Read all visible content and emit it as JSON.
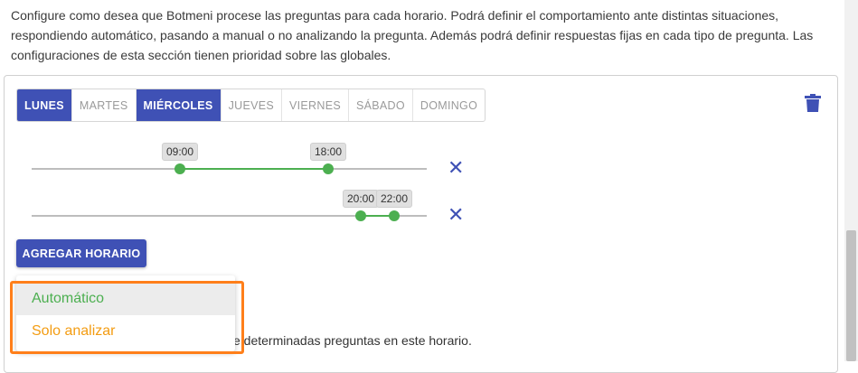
{
  "description": "Configure como desea que Botmeni procese las preguntas para cada horario. Podrá definir el comportamiento ante distintas situaciones, respondiendo automático, pasando a manual o no analizando la pregunta. Además podrá definir respuestas fijas en cada tipo de pregunta. Las configuraciones de esta sección tienen prioridad sobre las globales.",
  "days": [
    {
      "label": "LUNES",
      "active": true
    },
    {
      "label": "MARTES",
      "active": false
    },
    {
      "label": "MIÉRCOLES",
      "active": true
    },
    {
      "label": "JUEVES",
      "active": false
    },
    {
      "label": "VIERNES",
      "active": false
    },
    {
      "label": "SÁBADO",
      "active": false
    },
    {
      "label": "DOMINGO",
      "active": false
    }
  ],
  "schedules": [
    {
      "start": "09:00",
      "end": "18:00"
    },
    {
      "start": "20:00",
      "end": "22:00"
    }
  ],
  "add_button": "AGREGAR HORARIO",
  "partial_text": "e determinadas preguntas en este horario.",
  "dropdown": {
    "options": [
      "Automático",
      "Solo analizar"
    ]
  },
  "colors": {
    "primary": "#3f51b5",
    "success": "#4caf50",
    "warning": "#f39c12",
    "highlight": "#ff7f1a"
  },
  "icons": {
    "delete": "trash-icon",
    "remove": "close-icon"
  }
}
